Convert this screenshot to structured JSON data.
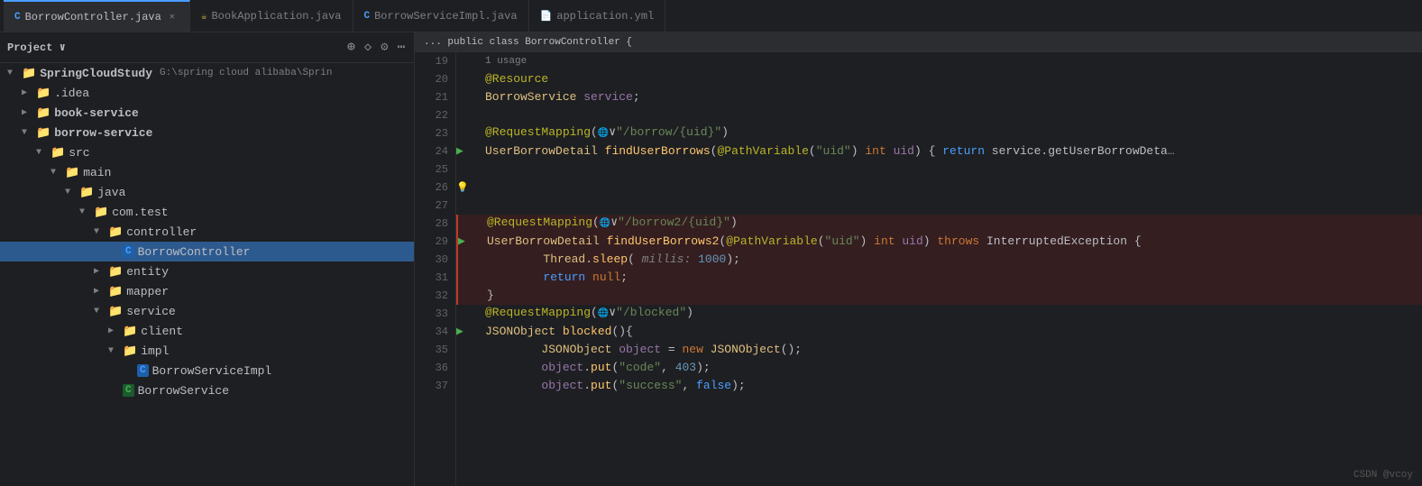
{
  "tabs": [
    {
      "id": "borrow-controller",
      "label": "BorrowController.java",
      "icon": "C",
      "active": true,
      "closeable": true
    },
    {
      "id": "book-application",
      "label": "BookApplication.java",
      "icon": "book",
      "active": false,
      "closeable": false
    },
    {
      "id": "borrow-serviceimpl",
      "label": "BorrowServiceImpl.java",
      "icon": "C",
      "active": false,
      "closeable": false
    },
    {
      "id": "application-yml",
      "label": "application.yml",
      "icon": "yml",
      "active": false,
      "closeable": false
    }
  ],
  "sidebar": {
    "title": "Project",
    "tree": [
      {
        "id": "root",
        "label": "SpringCloudStudy",
        "path": "G:\\spring cloud alibaba\\Sprin",
        "indent": 1,
        "type": "folder-open",
        "bold": true
      },
      {
        "id": "idea",
        "label": ".idea",
        "indent": 2,
        "type": "folder",
        "arrow": "▶"
      },
      {
        "id": "book-service",
        "label": "book-service",
        "indent": 2,
        "type": "folder",
        "arrow": "▶",
        "bold": true
      },
      {
        "id": "borrow-service",
        "label": "borrow-service",
        "indent": 2,
        "type": "folder-open",
        "arrow": "▼",
        "bold": true
      },
      {
        "id": "src",
        "label": "src",
        "indent": 3,
        "type": "folder-open",
        "arrow": "▼"
      },
      {
        "id": "main",
        "label": "main",
        "indent": 4,
        "type": "folder-open",
        "arrow": "▼"
      },
      {
        "id": "java",
        "label": "java",
        "indent": 5,
        "type": "folder-open",
        "arrow": "▼"
      },
      {
        "id": "com.test",
        "label": "com.test",
        "indent": 6,
        "type": "folder-open",
        "arrow": "▼"
      },
      {
        "id": "controller",
        "label": "controller",
        "indent": 7,
        "type": "folder-open",
        "arrow": "▼"
      },
      {
        "id": "BorrowController",
        "label": "BorrowController",
        "indent": 8,
        "type": "file-c"
      },
      {
        "id": "entity",
        "label": "entity",
        "indent": 7,
        "type": "folder",
        "arrow": "▶"
      },
      {
        "id": "mapper",
        "label": "mapper",
        "indent": 7,
        "type": "folder",
        "arrow": "▶"
      },
      {
        "id": "service",
        "label": "service",
        "indent": 7,
        "type": "folder-open",
        "arrow": "▼"
      },
      {
        "id": "client",
        "label": "client",
        "indent": 8,
        "type": "folder",
        "arrow": "▶"
      },
      {
        "id": "impl",
        "label": "impl",
        "indent": 8,
        "type": "folder-open",
        "arrow": "▼"
      },
      {
        "id": "BorrowServiceImpl",
        "label": "BorrowServiceImpl",
        "indent": 9,
        "type": "file-c"
      },
      {
        "id": "BorrowService",
        "label": "BorrowService",
        "indent": 8,
        "type": "file-g"
      }
    ]
  },
  "code": {
    "lines": [
      {
        "num": 19,
        "content": "",
        "gutter": "",
        "highlight": false
      },
      {
        "num": 20,
        "content": "    @Resource",
        "gutter": "",
        "highlight": false
      },
      {
        "num": 21,
        "content": "    BorrowService service;",
        "gutter": "",
        "highlight": false
      },
      {
        "num": 22,
        "content": "",
        "gutter": "",
        "highlight": false
      },
      {
        "num": 23,
        "content": "    @RequestMapping(\"&#xe0c2;\"/borrow/{uid}\")",
        "gutter": "",
        "highlight": false
      },
      {
        "num": 24,
        "content": "    UserBorrowDetail findUserBorrows(@PathVariable(\"uid\") int uid) { return service.getUserBorrowDeta",
        "gutter": "run",
        "highlight": false
      },
      {
        "num": 25,
        "content": "",
        "gutter": "",
        "highlight": false
      },
      {
        "num": 26,
        "content": "",
        "gutter": "bulb",
        "highlight": false
      },
      {
        "num": 27,
        "content": "",
        "gutter": "",
        "highlight": false
      },
      {
        "num": 28,
        "content": "    @RequestMapping(\"&#xe0c2;\"/borrow2/{uid}\")",
        "gutter": "",
        "highlight": true
      },
      {
        "num": 29,
        "content": "    UserBorrowDetail findUserBorrows2(@PathVariable(\"uid\") int uid) throws InterruptedException {",
        "gutter": "run",
        "highlight": true
      },
      {
        "num": 30,
        "content": "        Thread.sleep( millis: 1000);",
        "gutter": "",
        "highlight": true
      },
      {
        "num": 31,
        "content": "        return null;",
        "gutter": "",
        "highlight": true
      },
      {
        "num": 32,
        "content": "    }",
        "gutter": "",
        "highlight": true
      },
      {
        "num": 33,
        "content": "    @RequestMapping(\"&#xe0c2;\"/blocked\")",
        "gutter": "",
        "highlight": false
      },
      {
        "num": 34,
        "content": "    JSONObject blocked(){",
        "gutter": "run",
        "highlight": false
      },
      {
        "num": 35,
        "content": "        JSONObject object = new JSONObject();",
        "gutter": "",
        "highlight": false
      },
      {
        "num": 36,
        "content": "        object.put(\"code\", 403);",
        "gutter": "",
        "highlight": false
      },
      {
        "num": 37,
        "content": "        object.put(\"success\", false);",
        "gutter": "",
        "highlight": false
      }
    ],
    "usage_hint": "1 usage"
  },
  "watermark": "CSDN @vcoy"
}
